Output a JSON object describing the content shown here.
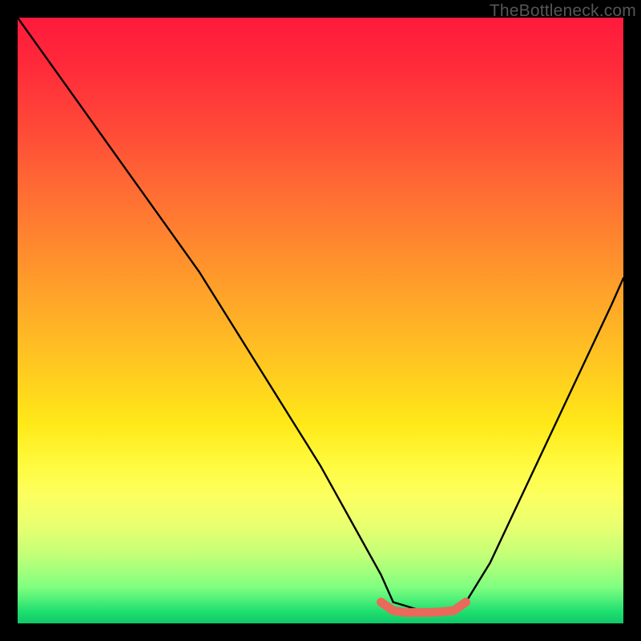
{
  "watermark": "TheBottleneck.com",
  "chart_data": {
    "type": "line",
    "title": "",
    "xlabel": "",
    "ylabel": "",
    "xlim": [
      0,
      100
    ],
    "ylim": [
      0,
      100
    ],
    "grid": false,
    "series": [
      {
        "name": "bottleneck-curve",
        "color": "#000000",
        "x": [
          0,
          5,
          10,
          15,
          20,
          25,
          30,
          35,
          40,
          45,
          50,
          55,
          60,
          62,
          67,
          72,
          74,
          78,
          82,
          86,
          90,
          94,
          98,
          100
        ],
        "values": [
          100,
          93,
          86,
          79,
          72,
          65,
          58,
          50,
          42,
          34,
          26,
          17,
          8,
          3.5,
          2,
          2,
          3.5,
          10,
          18.5,
          27,
          35.5,
          44,
          52.5,
          57
        ]
      },
      {
        "name": "flat-minimum-marker",
        "color": "#e9695b",
        "x": [
          60,
          62,
          64,
          66,
          68,
          70,
          72,
          74
        ],
        "values": [
          3.5,
          2.1,
          1.8,
          1.8,
          1.8,
          1.9,
          2.1,
          3.5
        ]
      }
    ],
    "background_gradient": {
      "top": "#ff1a3c",
      "upper_mid": "#ffaa28",
      "mid": "#ffe818",
      "lower_mid": "#c0ff78",
      "bottom": "#10c868"
    }
  }
}
